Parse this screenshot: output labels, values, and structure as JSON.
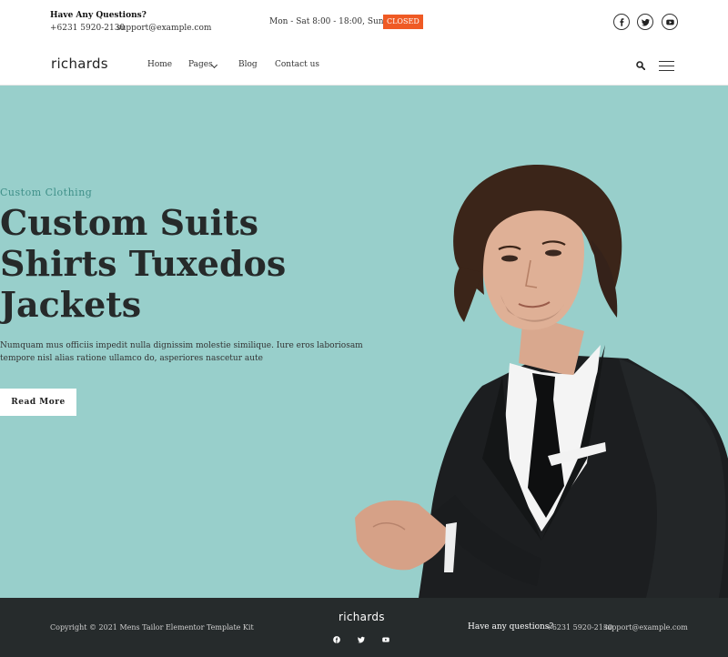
{
  "topbar": {
    "question": "Have Any Questions?",
    "phone": "+6231 5920-2130",
    "email": "support@example.com",
    "hours": "Mon - Sat 8:00 - 18:00,  Sunday",
    "closed_badge": "CLOSED",
    "closed_color": "#ef5a24",
    "social_icons": [
      "facebook-icon",
      "twitter-icon",
      "youtube-icon"
    ]
  },
  "nav": {
    "logo": "richards",
    "items": [
      "Home",
      "Pages",
      "Blog",
      "Contact us"
    ],
    "icons": [
      "search-icon",
      "hamburger-menu-icon"
    ]
  },
  "hero": {
    "background_color": "#98cfcb",
    "eyebrow": "Custom Clothing",
    "headline_lines": [
      "Custom Suits",
      "Shirts Tuxedos",
      "Jackets"
    ],
    "description": "Numquam mus officiis impedit nulla dignissim molestie similique. Iure eros laboriosam tempore nisl alias ratione ullamco do, asperiores nascetur aute",
    "button": "Read More"
  },
  "footer": {
    "copyright": "Copyright © 2021 Mens Tailor Elementor Template Kit",
    "logo": "richards",
    "question": "Have any questions?",
    "phone": "+6231 5920-2130",
    "email": "support@example.com",
    "social_icons": [
      "facebook-icon",
      "twitter-icon",
      "youtube-icon"
    ]
  }
}
